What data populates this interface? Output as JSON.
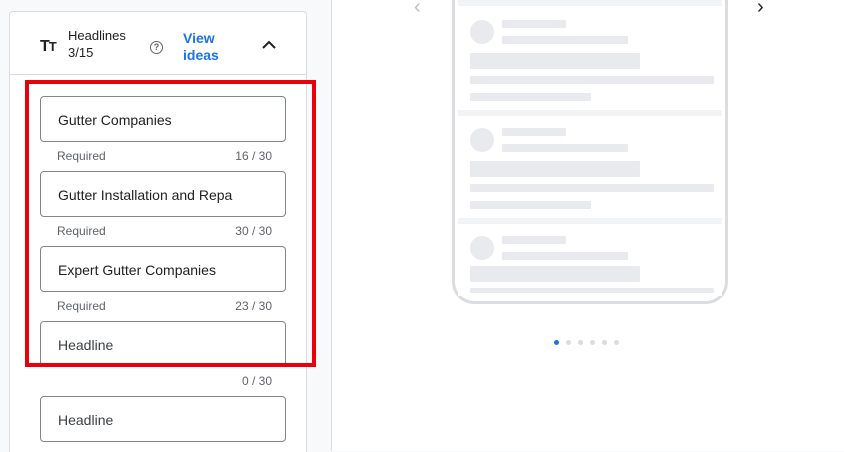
{
  "headlines": {
    "title": "Headlines",
    "count": "3/15",
    "view_ideas": "View ideas",
    "icon": "text-fields-icon",
    "fields": [
      {
        "value": "Gutter Companies",
        "helper": "Required",
        "counter": "16 / 30"
      },
      {
        "value": "Gutter Installation and Repa",
        "helper": "Required",
        "counter": "30 / 30"
      },
      {
        "value": "Expert Gutter Companies",
        "helper": "Required",
        "counter": "23 / 30"
      },
      {
        "value": "",
        "placeholder": "Headline",
        "helper": "",
        "counter": "0 / 30"
      },
      {
        "value": "",
        "placeholder": "Headline",
        "helper": "",
        "counter": ""
      }
    ]
  },
  "preview": {
    "pagination_total": 6,
    "pagination_active": 1
  },
  "colors": {
    "accent": "#1a73e8",
    "highlight": "#e8000b"
  }
}
